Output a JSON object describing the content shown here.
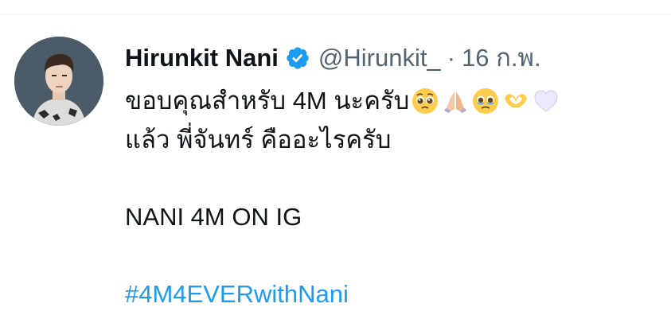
{
  "tweet": {
    "author_name": "Hirunkit Nani",
    "handle": "@Hirunkit_",
    "separator": "·",
    "timestamp": "16 ก.พ.",
    "line1": "ขอบคุณสำหรับ 4M นะครับ",
    "line2": "แล้ว พี่จันทร์ คืออะไรครับ",
    "line3": "NANI 4M ON IG",
    "hashtag": "#4M4EVERwithNani",
    "emojis": [
      "pleading-face",
      "folded-hands",
      "face-holding-back-tears",
      "heart-hands",
      "white-heart"
    ]
  },
  "colors": {
    "text": "#0f1419",
    "secondary": "#536471",
    "link": "#1d9bf0",
    "verified": "#1d9bf0"
  }
}
